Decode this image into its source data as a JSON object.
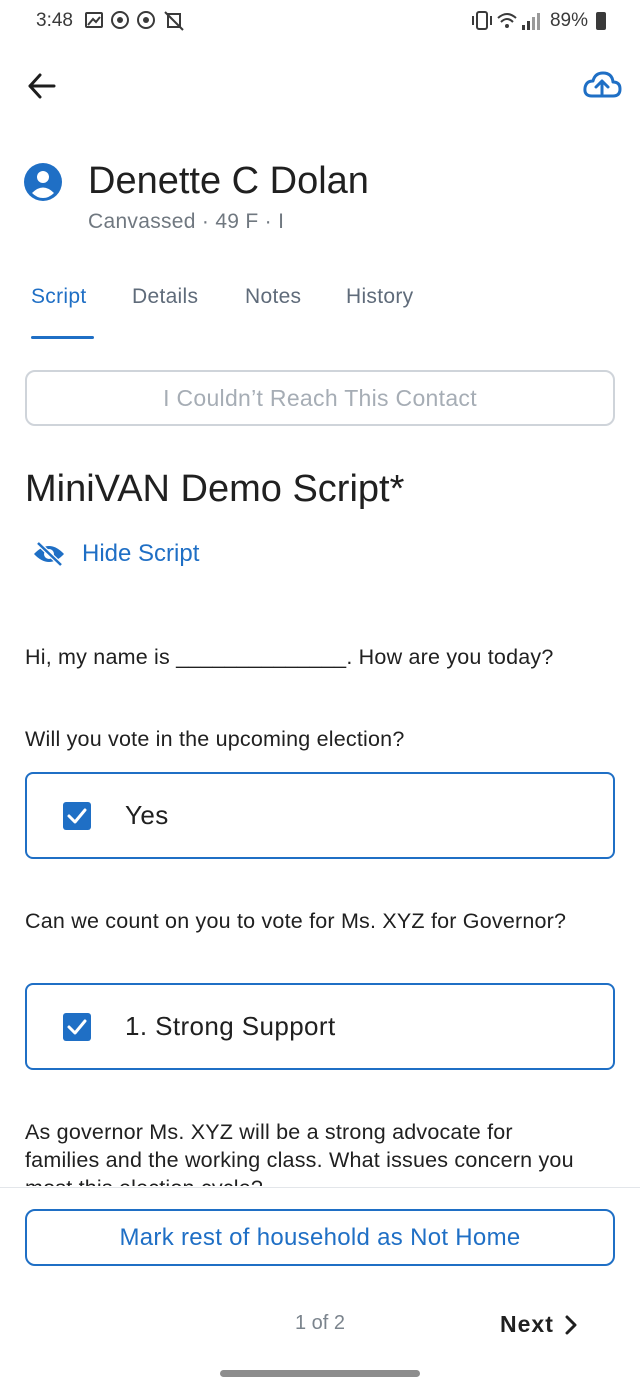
{
  "status": {
    "time": "3:48",
    "battery": "89%"
  },
  "header": {
    "back_icon": "arrow-left-icon",
    "upload_icon": "cloud-upload-icon"
  },
  "contact": {
    "name": "Denette C Dolan",
    "subtitle": "Canvassed · 49 F · I"
  },
  "tabs": [
    {
      "label": "Script",
      "active": true
    },
    {
      "label": "Details",
      "active": false
    },
    {
      "label": "Notes",
      "active": false
    },
    {
      "label": "History",
      "active": false
    }
  ],
  "actions": {
    "couldnt_reach": "I Couldn’t Reach This Contact",
    "hide_script": "Hide Script",
    "mark_household": "Mark rest of household as Not Home"
  },
  "script": {
    "title": "MiniVAN Demo Script*",
    "intro": "Hi, my name is ______________. How are you today?",
    "q1": "Will you vote in the upcoming election?",
    "q1_answer": "Yes",
    "q2": "Can we count on you to vote for Ms. XYZ for Governor?",
    "q2_answer": "1. Strong Support",
    "q3": "As governor Ms. XYZ will be a strong advocate for families and the working class.  What issues concern you most this election cycle?"
  },
  "footer": {
    "pager": "1 of 2",
    "next": "Next"
  },
  "colors": {
    "accent": "#1f6fc5"
  }
}
